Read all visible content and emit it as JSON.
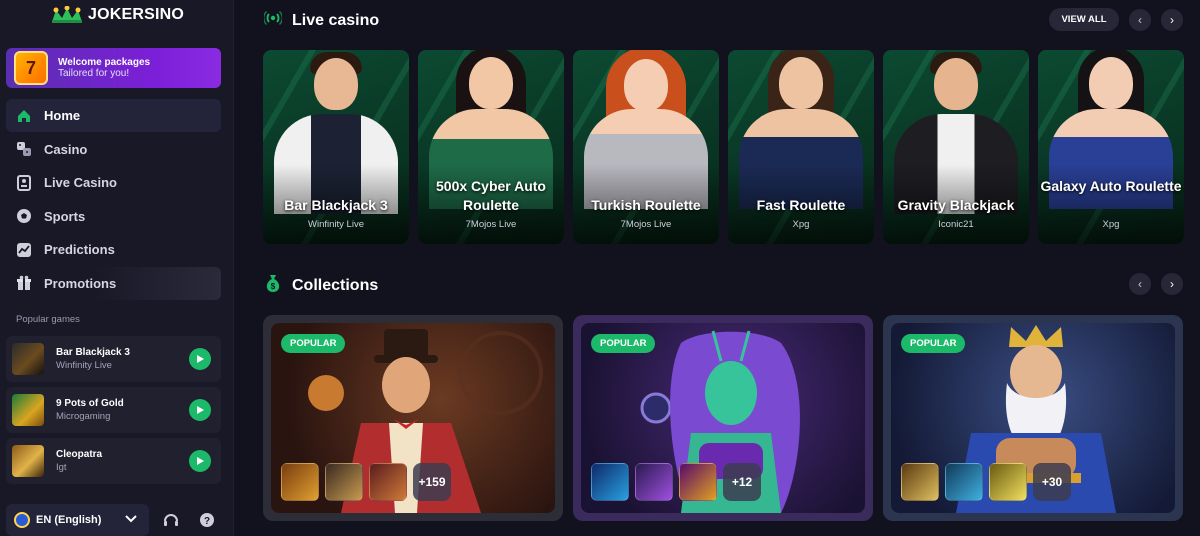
{
  "brand": {
    "name": "JOKERSINO"
  },
  "promo": {
    "title": "Welcome packages",
    "subtitle": "Tailored for you!",
    "badge": "7"
  },
  "nav": [
    {
      "label": "Home",
      "icon": "home-icon"
    },
    {
      "label": "Casino",
      "icon": "dice-icon"
    },
    {
      "label": "Live Casino",
      "icon": "live-dealer-icon"
    },
    {
      "label": "Sports",
      "icon": "soccer-ball-icon"
    },
    {
      "label": "Predictions",
      "icon": "trend-chart-icon"
    },
    {
      "label": "Promotions",
      "icon": "gift-icon"
    }
  ],
  "popular": {
    "label": "Popular games",
    "items": [
      {
        "name": "Bar Blackjack 3",
        "provider": "Winfinity Live"
      },
      {
        "name": "9 Pots of Gold",
        "provider": "Microgaming"
      },
      {
        "name": "Cleopatra",
        "provider": "Igt"
      }
    ]
  },
  "footer": {
    "language": "EN (English)"
  },
  "live": {
    "title": "Live casino",
    "view_all": "VIEW ALL",
    "cards": [
      {
        "title": "Bar Blackjack 3",
        "provider": "Winfinity Live"
      },
      {
        "title": "500x Cyber Auto Roulette",
        "provider": "7Mojos Live"
      },
      {
        "title": "Turkish Roulette",
        "provider": "7Mojos Live"
      },
      {
        "title": "Fast Roulette",
        "provider": "Xpg"
      },
      {
        "title": "Gravity Blackjack",
        "provider": "Iconic21"
      },
      {
        "title": "Galaxy Auto Roulette",
        "provider": "Xpg"
      }
    ]
  },
  "collections": {
    "title": "Collections",
    "cards": [
      {
        "badge": "POPULAR",
        "more": "+159"
      },
      {
        "badge": "POPULAR",
        "more": "+12"
      },
      {
        "badge": "POPULAR",
        "more": "+30"
      }
    ]
  },
  "colors": {
    "accent": "#1db96a",
    "bg": "#12121e",
    "promo": "#7c1fd8"
  }
}
